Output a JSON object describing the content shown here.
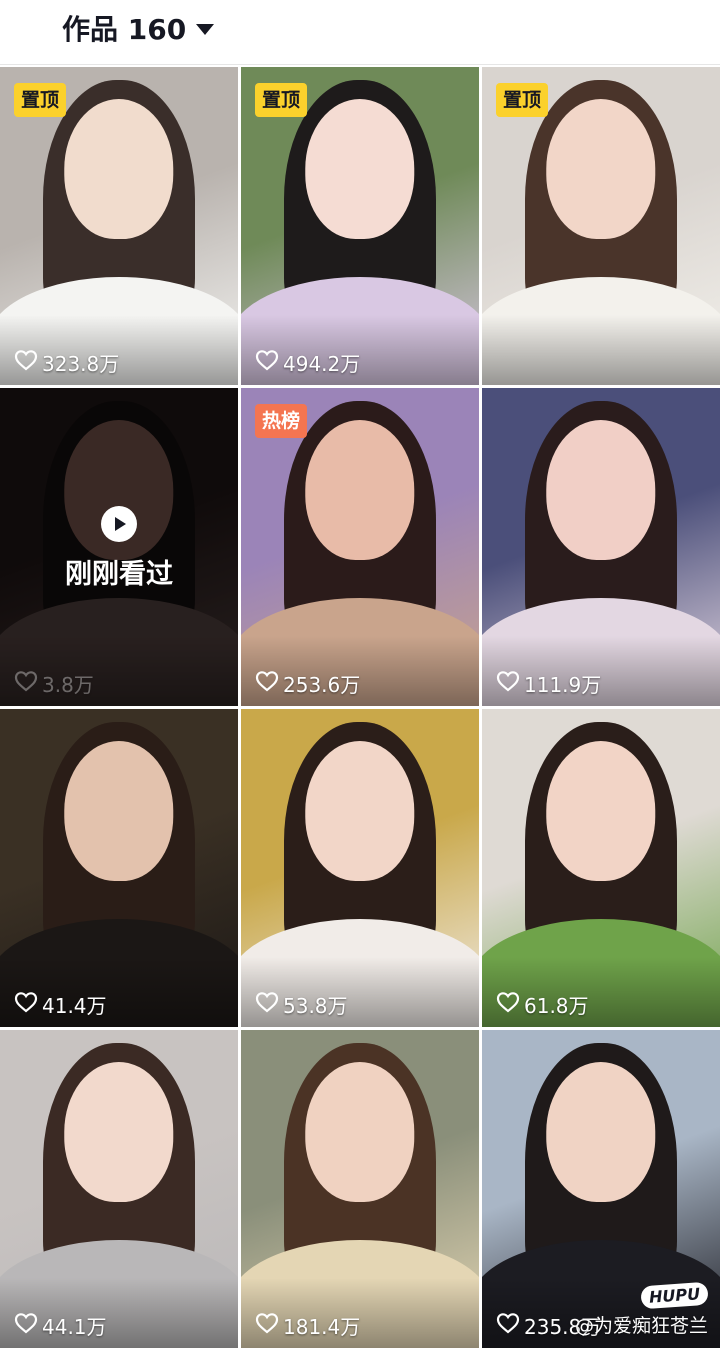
{
  "header": {
    "title": "作品 160"
  },
  "tiles": [
    {
      "badge": "置顶",
      "badge_type": "pin",
      "likes": "323.8万",
      "colors": [
        "#b9b3ae",
        "#3a2e2a",
        "#f1dccd",
        "#f4f4f2"
      ]
    },
    {
      "badge": "置顶",
      "badge_type": "pin",
      "likes": "494.2万",
      "colors": [
        "#6f8a58",
        "#1e1b1b",
        "#f5dcd3",
        "#d9c8e3"
      ]
    },
    {
      "badge": "置顶",
      "badge_type": "pin",
      "likes": "",
      "colors": [
        "#d9d4cf",
        "#4a342a",
        "#f2d6c8",
        "#f3f1ec"
      ]
    },
    {
      "badge": "",
      "badge_type": "",
      "likes": "3.8万",
      "watched": "刚刚看过",
      "colors": [
        "#1d1414",
        "#120d0d",
        "#6b4b44",
        "#4a3b39"
      ]
    },
    {
      "badge": "热榜",
      "badge_type": "hot",
      "likes": "253.6万",
      "colors": [
        "#9b84b8",
        "#2b1b1a",
        "#e8bba8",
        "#c9a48c"
      ]
    },
    {
      "badge": "",
      "badge_type": "",
      "likes": "111.9万",
      "colors": [
        "#4b4f7a",
        "#2a1c1c",
        "#f1cfc6",
        "#e3d7e2"
      ]
    },
    {
      "badge": "",
      "badge_type": "",
      "likes": "41.4万",
      "colors": [
        "#3a3024",
        "#2a1d17",
        "#e3c2ad",
        "#1b1715"
      ]
    },
    {
      "badge": "",
      "badge_type": "",
      "likes": "53.8万",
      "colors": [
        "#c9a84a",
        "#2b1e19",
        "#f2d6c8",
        "#f1ece8"
      ]
    },
    {
      "badge": "",
      "badge_type": "",
      "likes": "61.8万",
      "colors": [
        "#dfdad4",
        "#2a1e1a",
        "#f2d4c6",
        "#6fa34a"
      ]
    },
    {
      "badge": "",
      "badge_type": "",
      "likes": "44.1万",
      "colors": [
        "#c8c3c1",
        "#3b2a24",
        "#f2d9cc",
        "#b9b7b8"
      ]
    },
    {
      "badge": "",
      "badge_type": "",
      "likes": "181.4万",
      "colors": [
        "#8a8f7a",
        "#4b3325",
        "#f0d2c1",
        "#e4d6b4"
      ]
    },
    {
      "badge": "",
      "badge_type": "",
      "likes": "235.8万",
      "colors": [
        "#a9b6c6",
        "#1f1a1a",
        "#f0d3c4",
        "#1c1c22"
      ]
    }
  ],
  "watermark": {
    "logo": "HUPU",
    "text": "@为爱痴狂苍兰"
  },
  "icons": {
    "heart": "heart-outline-icon",
    "play": "play-icon",
    "caret": "caret-down-icon"
  }
}
